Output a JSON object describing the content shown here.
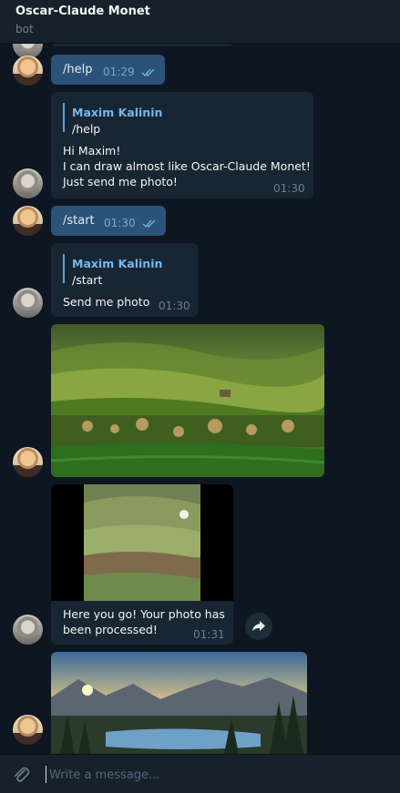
{
  "header": {
    "title": "Oscar-Claude Monet",
    "status": "bot"
  },
  "messages": [
    {
      "type": "outgoing",
      "text": "/help",
      "time": "01:29",
      "read": true
    },
    {
      "type": "incoming",
      "reply_name": "Maxim Kalinin",
      "reply_text": "/help",
      "text": "Hi Maxim!\nI can draw almost like Oscar-Claude Monet!\nJust send me photo!",
      "time": "01:30"
    },
    {
      "type": "outgoing",
      "text": "/start",
      "time": "01:30",
      "read": true
    },
    {
      "type": "incoming",
      "reply_name": "Maxim Kalinin",
      "reply_text": "/start",
      "text": "Send me photo",
      "time": "01:30"
    },
    {
      "type": "outgoing-photo",
      "subject": "green rolling hills landscape"
    },
    {
      "type": "incoming-photo",
      "subject": "processed painting of hills",
      "text": "Here you go! Your photo has been processed!",
      "time": "01:31"
    },
    {
      "type": "outgoing-photo",
      "subject": "mountain lake with pine trees at sunset"
    }
  ],
  "composer": {
    "placeholder": "Write a message..."
  },
  "icons": {
    "attach": "paperclip-icon",
    "forward": "share-arrow-icon",
    "read": "double-check-icon"
  }
}
